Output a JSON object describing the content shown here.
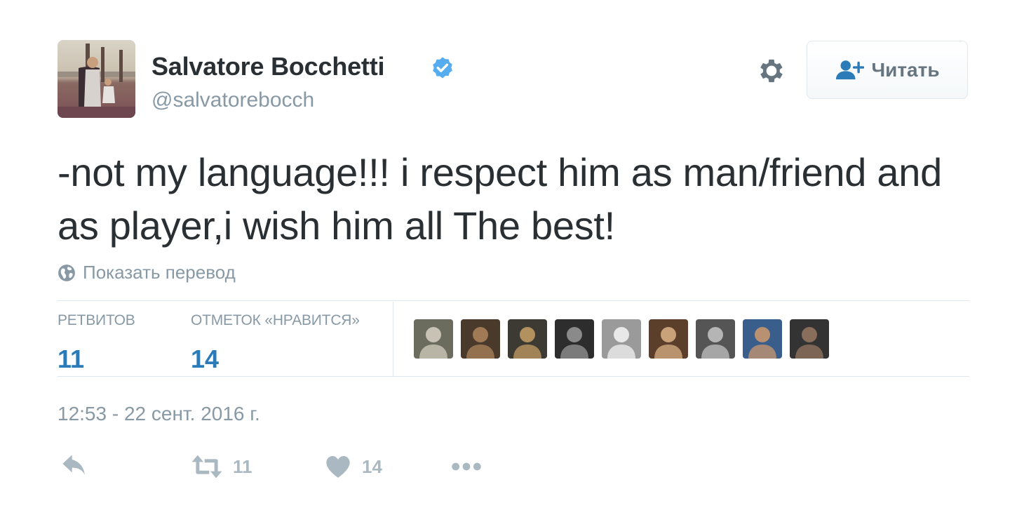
{
  "author": {
    "name": "Salvatore Bocchetti",
    "handle": "@salvatorebocch",
    "verified": true
  },
  "follow_button": {
    "label": "Читать"
  },
  "tweet": {
    "text": "-not my language!!! i respect him as man/friend and as player,i wish him all The best!",
    "translate_label": "Показать перевод",
    "timestamp": "12:53 - 22 сент. 2016 г."
  },
  "stats": {
    "retweets_label": "РЕТВИТОВ",
    "retweets_count": "11",
    "likes_label": "ОТМЕТОК «НРАВИТСЯ»",
    "likes_count": "14"
  },
  "actions": {
    "retweet_count": "11",
    "like_count": "14"
  },
  "likers": [
    {
      "colors": [
        "#6b6b5e",
        "#c7c2b3"
      ]
    },
    {
      "colors": [
        "#4a3a2c",
        "#a07a55"
      ]
    },
    {
      "colors": [
        "#3d3a33",
        "#b3915e"
      ]
    },
    {
      "colors": [
        "#2d2d2d",
        "#8a8a8a"
      ]
    },
    {
      "colors": [
        "#9a9a9a",
        "#e8e8e8"
      ]
    },
    {
      "colors": [
        "#5b3f2a",
        "#c9a27a"
      ]
    },
    {
      "colors": [
        "#555555",
        "#b5b5b5"
      ]
    },
    {
      "colors": [
        "#3a5e8c",
        "#b89072"
      ]
    },
    {
      "colors": [
        "#333333",
        "#8a6e5c"
      ]
    }
  ],
  "colors": {
    "link_blue": "#2b7bb9",
    "verified_blue": "#55acee",
    "muted": "#8899a6",
    "icon_muted": "#aab8c2"
  }
}
